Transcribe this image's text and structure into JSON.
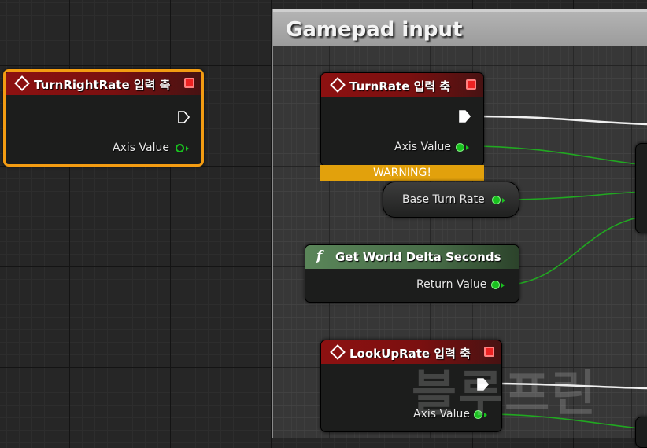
{
  "comment": {
    "title": "Gamepad input"
  },
  "nodes": {
    "turn_right_rate": {
      "title": "TurnRightRate 입력 축",
      "axis_label": "Axis Value"
    },
    "turn_rate": {
      "title": "TurnRate 입력 축",
      "axis_label": "Axis Value",
      "warning": "WARNING!"
    },
    "base_turn_rate": {
      "label": "Base Turn Rate"
    },
    "get_world_delta_seconds": {
      "icon": "function-icon",
      "icon_glyph": "f",
      "title": "Get World Delta Seconds",
      "return_label": "Return Value"
    },
    "look_up_rate": {
      "title": "LookUpRate 입력 축",
      "axis_label": "Axis Value"
    }
  },
  "watermark": "블루프린",
  "colors": {
    "event_header": "#8d1111",
    "function_header": "#5a8559",
    "float_pin": "#19c21f",
    "selection": "#f39c12",
    "warning": "#e2a10c",
    "comment_header": "#a8a8a8"
  }
}
